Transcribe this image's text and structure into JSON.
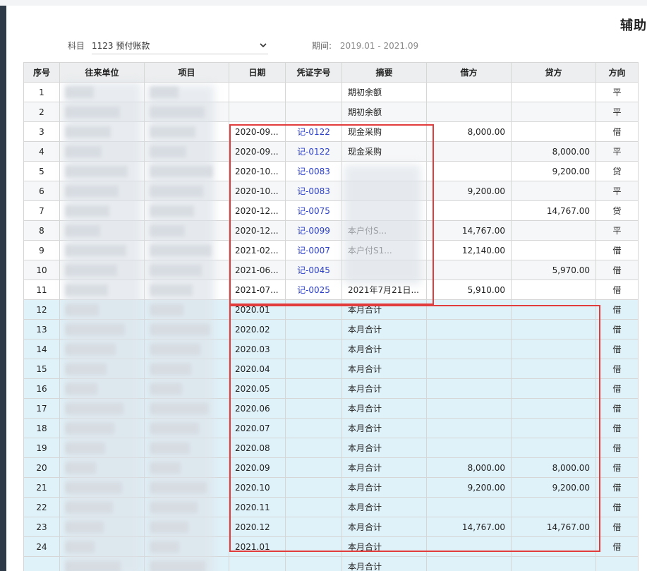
{
  "report_title": "辅助",
  "filter": {
    "subject_label": "科目",
    "subject_value": "1123 预付账款",
    "period_label": "期间:",
    "period_value": "2019.01 - 2021.09"
  },
  "columns": [
    "序号",
    "往来单位",
    "项目",
    "日期",
    "凭证字号",
    "摘要",
    "借方",
    "贷方",
    "方向"
  ],
  "rows": [
    {
      "no": "1",
      "date": "",
      "voucher": "",
      "summary": "期初余额",
      "debit": "",
      "credit": "",
      "dir": "平",
      "type": "normal"
    },
    {
      "no": "2",
      "date": "",
      "voucher": "",
      "summary": "期初余额",
      "debit": "",
      "credit": "",
      "dir": "平",
      "type": "alt"
    },
    {
      "no": "3",
      "date": "2020-09...",
      "voucher": "记-0122",
      "summary": "现金采购",
      "debit": "8,000.00",
      "credit": "",
      "dir": "借",
      "type": "normal"
    },
    {
      "no": "4",
      "date": "2020-09...",
      "voucher": "记-0122",
      "summary": "现金采购",
      "debit": "",
      "credit": "8,000.00",
      "dir": "平",
      "type": "alt"
    },
    {
      "no": "5",
      "date": "2020-10...",
      "voucher": "记-0083",
      "summary": "",
      "debit": "",
      "credit": "9,200.00",
      "dir": "贷",
      "type": "normal"
    },
    {
      "no": "6",
      "date": "2020-10...",
      "voucher": "记-0083",
      "summary": "",
      "debit": "9,200.00",
      "credit": "",
      "dir": "平",
      "type": "alt"
    },
    {
      "no": "7",
      "date": "2020-12...",
      "voucher": "记-0075",
      "summary": "",
      "debit": "",
      "credit": "14,767.00",
      "dir": "贷",
      "type": "normal"
    },
    {
      "no": "8",
      "date": "2020-12...",
      "voucher": "记-0099",
      "summary": "本户付S...",
      "debit": "14,767.00",
      "credit": "",
      "dir": "平",
      "type": "alt"
    },
    {
      "no": "9",
      "date": "2021-02...",
      "voucher": "记-0007",
      "summary": "本户付S1...",
      "debit": "12,140.00",
      "credit": "",
      "dir": "借",
      "type": "normal"
    },
    {
      "no": "10",
      "date": "2021-06...",
      "voucher": "记-0045",
      "summary": "",
      "debit": "",
      "credit": "5,970.00",
      "dir": "借",
      "type": "alt"
    },
    {
      "no": "11",
      "date": "2021-07...",
      "voucher": "记-0025",
      "summary": "2021年7月21日...",
      "debit": "5,910.00",
      "credit": "",
      "dir": "借",
      "type": "normal"
    },
    {
      "no": "12",
      "date": "2020.01",
      "voucher": "",
      "summary": "本月合计",
      "debit": "",
      "credit": "",
      "dir": "借",
      "type": "sub"
    },
    {
      "no": "13",
      "date": "2020.02",
      "voucher": "",
      "summary": "本月合计",
      "debit": "",
      "credit": "",
      "dir": "借",
      "type": "sub"
    },
    {
      "no": "14",
      "date": "2020.03",
      "voucher": "",
      "summary": "本月合计",
      "debit": "",
      "credit": "",
      "dir": "借",
      "type": "sub"
    },
    {
      "no": "15",
      "date": "2020.04",
      "voucher": "",
      "summary": "本月合计",
      "debit": "",
      "credit": "",
      "dir": "借",
      "type": "sub"
    },
    {
      "no": "16",
      "date": "2020.05",
      "voucher": "",
      "summary": "本月合计",
      "debit": "",
      "credit": "",
      "dir": "借",
      "type": "sub"
    },
    {
      "no": "17",
      "date": "2020.06",
      "voucher": "",
      "summary": "本月合计",
      "debit": "",
      "credit": "",
      "dir": "借",
      "type": "sub"
    },
    {
      "no": "18",
      "date": "2020.07",
      "voucher": "",
      "summary": "本月合计",
      "debit": "",
      "credit": "",
      "dir": "借",
      "type": "sub"
    },
    {
      "no": "19",
      "date": "2020.08",
      "voucher": "",
      "summary": "本月合计",
      "debit": "",
      "credit": "",
      "dir": "借",
      "type": "sub"
    },
    {
      "no": "20",
      "date": "2020.09",
      "voucher": "",
      "summary": "本月合计",
      "debit": "8,000.00",
      "credit": "8,000.00",
      "dir": "借",
      "type": "sub"
    },
    {
      "no": "21",
      "date": "2020.10",
      "voucher": "",
      "summary": "本月合计",
      "debit": "9,200.00",
      "credit": "9,200.00",
      "dir": "借",
      "type": "sub"
    },
    {
      "no": "22",
      "date": "2020.11",
      "voucher": "",
      "summary": "本月合计",
      "debit": "",
      "credit": "",
      "dir": "借",
      "type": "sub"
    },
    {
      "no": "23",
      "date": "2020.12",
      "voucher": "",
      "summary": "本月合计",
      "debit": "14,767.00",
      "credit": "14,767.00",
      "dir": "借",
      "type": "sub"
    },
    {
      "no": "24",
      "date": "2021.01",
      "voucher": "",
      "summary": "本月合计",
      "debit": "",
      "credit": "",
      "dir": "借",
      "type": "sub"
    },
    {
      "no": "",
      "date": "",
      "voucher": "",
      "summary": "本月合计",
      "debit": "",
      "credit": "",
      "dir": "",
      "type": "sub"
    }
  ],
  "colors": {
    "link": "#2b3fc8",
    "highlight_row": "#e0f2f9",
    "annotation": "#e23c3c",
    "sidebar": "#2f3a48"
  }
}
